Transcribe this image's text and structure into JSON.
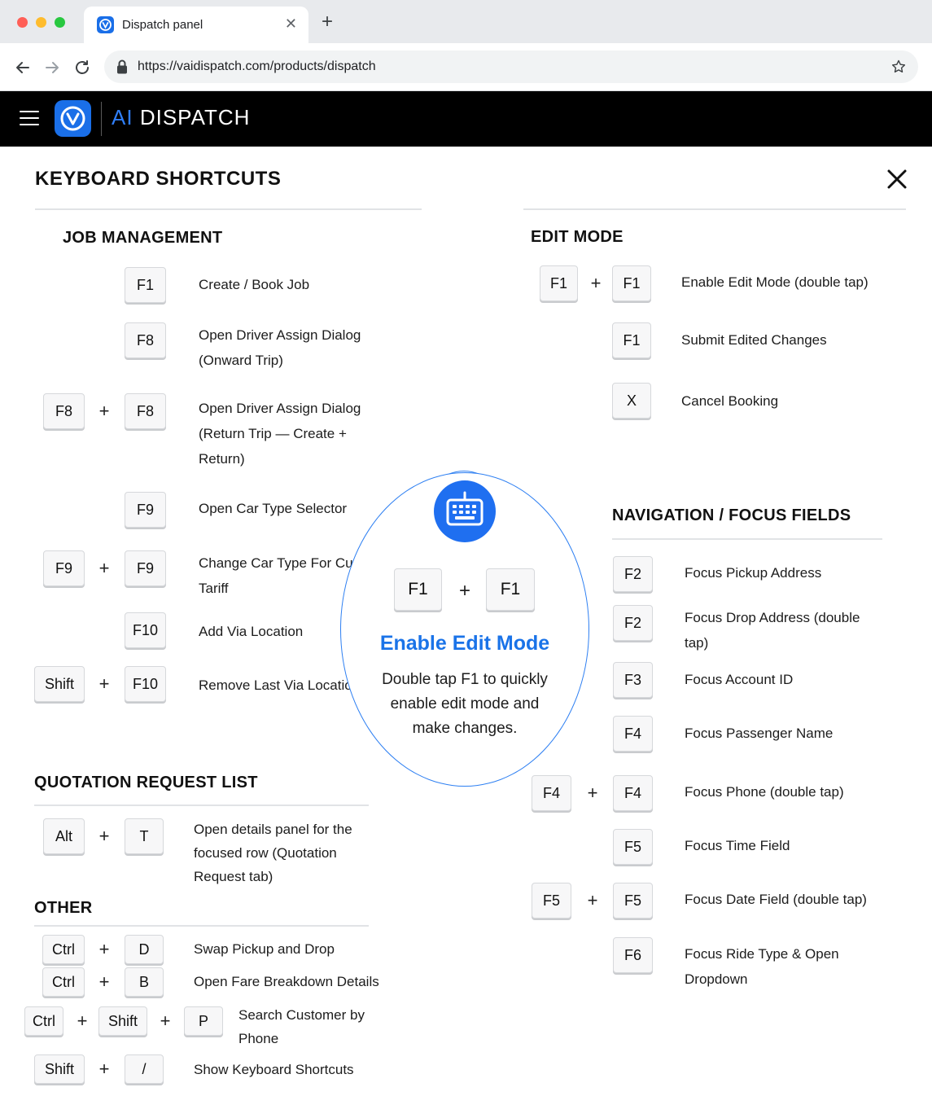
{
  "browser": {
    "tab_title": "Dispatch panel",
    "url": "https://vaidispatch.com/products/dispatch"
  },
  "app": {
    "brand_prefix": "AI",
    "brand_name": "DISPATCH",
    "accent_color": "#2f7ef7"
  },
  "panel": {
    "title": "KEYBOARD SHORTCUTS"
  },
  "job_management": {
    "title": "JOB MANAGEMENT",
    "items": [
      {
        "keys": [
          "F1"
        ],
        "desc": "Create / Book Job"
      },
      {
        "keys": [
          "F8"
        ],
        "desc_lines": [
          "Open Driver Assign Dialog",
          "(Onward Trip)"
        ]
      },
      {
        "keys": [
          "F8",
          "F8"
        ],
        "desc_lines": [
          "Open Driver Assign Dialog",
          "(Return Trip — Create +",
          "Return)"
        ]
      },
      {
        "keys": [
          "F9"
        ],
        "desc": "Open Car Type Selector"
      },
      {
        "keys": [
          "F9",
          "F9"
        ],
        "desc_lines": [
          "Change Car Type For Cust",
          "Tariff"
        ]
      },
      {
        "keys": [
          "F10"
        ],
        "desc": "Add Via Location"
      },
      {
        "keys": [
          "Shift",
          "F10"
        ],
        "desc": "Remove Last Via Locatio"
      }
    ]
  },
  "quotation": {
    "title": "QUOTATION REQUEST LIST",
    "items": [
      {
        "keys": [
          "Alt",
          "T"
        ],
        "desc_lines": [
          "Open details panel for the",
          "focused row (Quotation",
          "Request tab)"
        ]
      }
    ]
  },
  "other": {
    "title": "OTHER",
    "items": [
      {
        "keys": [
          "Ctrl",
          "D"
        ],
        "desc": "Swap Pickup and Drop"
      },
      {
        "keys": [
          "Ctrl",
          "B"
        ],
        "desc": "Open Fare Breakdown Details"
      },
      {
        "keys": [
          "Ctrl",
          "Shift",
          "P"
        ],
        "desc_lines": [
          "Search Customer by",
          "Phone"
        ]
      },
      {
        "keys": [
          "Shift",
          "/"
        ],
        "desc": "Show Keyboard Shortcuts"
      }
    ]
  },
  "edit_mode": {
    "title": "EDIT MODE",
    "items": [
      {
        "keys": [
          "F1",
          "F1"
        ],
        "desc": "Enable Edit Mode (double tap)"
      },
      {
        "keys": [
          "F1"
        ],
        "desc": "Submit Edited Changes"
      },
      {
        "keys": [
          "X"
        ],
        "desc": "Cancel Booking"
      }
    ]
  },
  "navigation": {
    "title": "NAVIGATION / FOCUS FIELDS",
    "items": [
      {
        "keys": [
          "F2"
        ],
        "desc": "Focus Pickup Address"
      },
      {
        "keys": [
          "F2"
        ],
        "desc_lines": [
          "Focus Drop Address (double",
          "tap)"
        ]
      },
      {
        "keys": [
          "F3"
        ],
        "desc": "Focus Account ID"
      },
      {
        "keys": [
          "F4"
        ],
        "desc": "Focus Passenger Name"
      },
      {
        "keys": [
          "F4",
          "F4"
        ],
        "desc": "Focus Phone (double tap)"
      },
      {
        "keys": [
          "F5"
        ],
        "desc": "Focus Time Field"
      },
      {
        "keys": [
          "F5",
          "F5"
        ],
        "desc": "Focus Date Field (double tap)"
      },
      {
        "keys": [
          "F6"
        ],
        "desc_lines": [
          "Focus Ride Type & Open",
          "Dropdown"
        ]
      }
    ]
  },
  "plus_sign": "+",
  "callout": {
    "keys": [
      "F1",
      "F1"
    ],
    "title": "Enable Edit Mode",
    "text_lines": [
      "Double tap F1 to quickly",
      "enable edit mode and",
      "make changes."
    ],
    "icon": "keyboard-icon"
  }
}
